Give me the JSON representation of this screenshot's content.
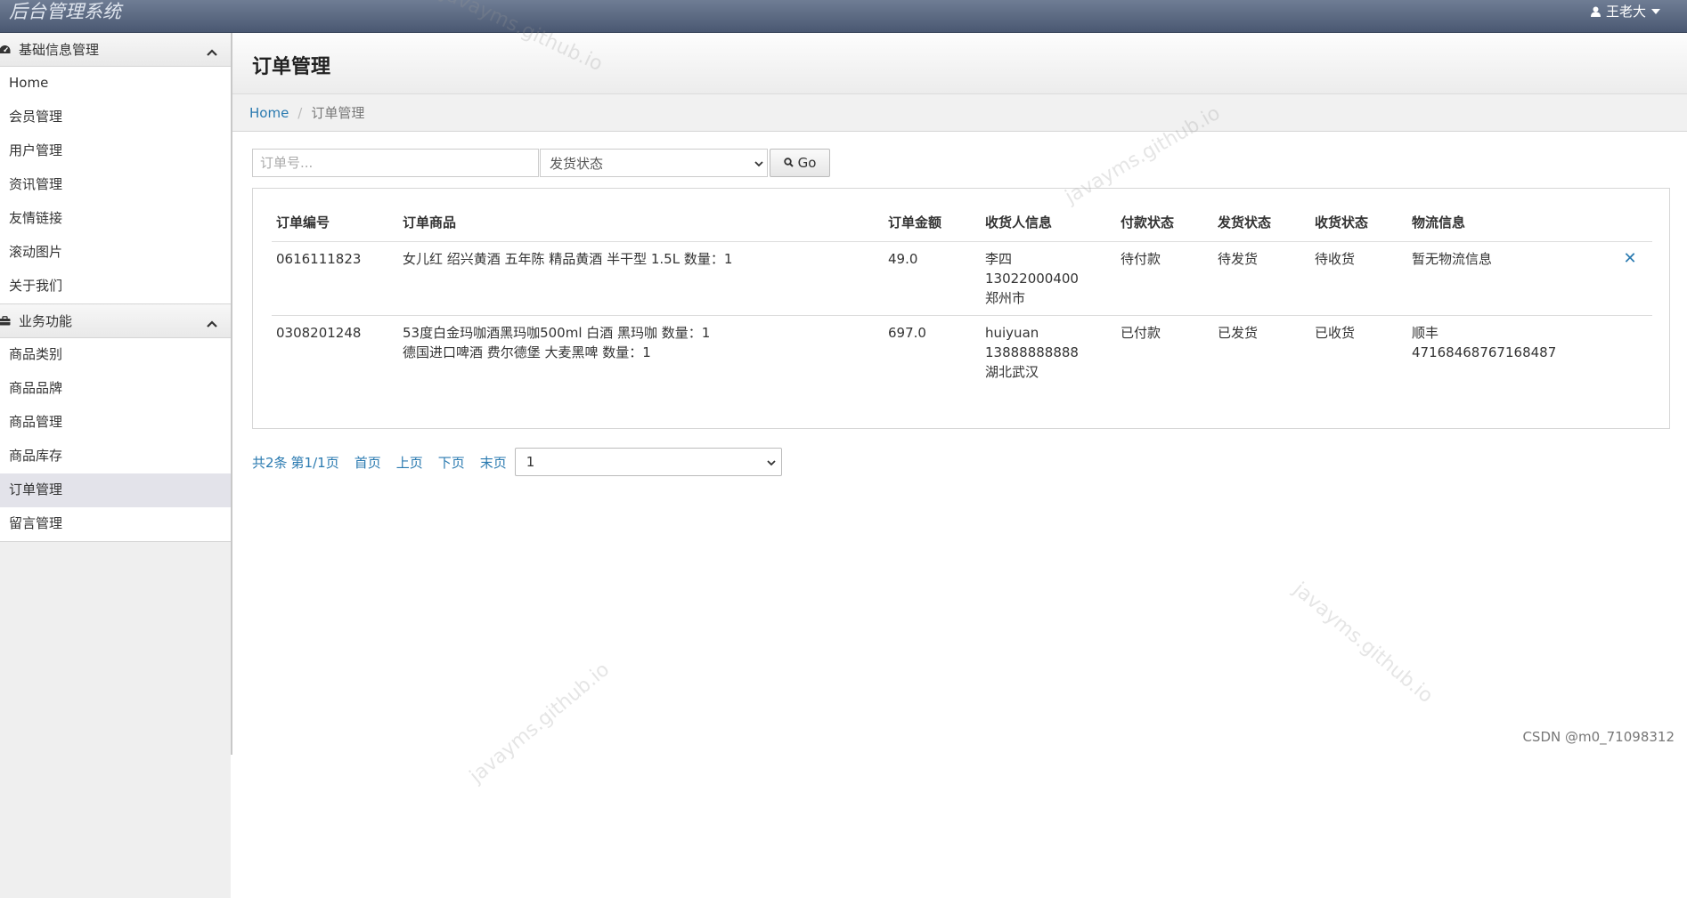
{
  "topbar": {
    "brand": "后台管理系统",
    "user_name": "王老大"
  },
  "sidebar": {
    "groups": [
      {
        "title": "基础信息管理",
        "items": [
          "Home",
          "会员管理",
          "用户管理",
          "资讯管理",
          "友情链接",
          "滚动图片",
          "关于我们"
        ]
      },
      {
        "title": "业务功能",
        "items": [
          "商品类别",
          "商品品牌",
          "商品管理",
          "商品库存",
          "订单管理",
          "留言管理"
        ]
      }
    ],
    "active_item": "订单管理"
  },
  "page": {
    "title": "订单管理"
  },
  "breadcrumb": {
    "home": "Home",
    "separator": "/",
    "current": "订单管理"
  },
  "filter": {
    "order_placeholder": "订单号...",
    "status_select_value": "发货状态",
    "go_label": "Go"
  },
  "table": {
    "headers": [
      "订单编号",
      "订单商品",
      "订单金额",
      "收货人信息",
      "付款状态",
      "发货状态",
      "收货状态",
      "物流信息"
    ],
    "rows": [
      {
        "order_no": "0616111823",
        "goods": [
          "女儿红 绍兴黄酒 五年陈 精品黄酒 半干型 1.5L   数量：1"
        ],
        "amount": "49.0",
        "receiver": [
          "李四",
          "13022000400",
          "郑州市"
        ],
        "pay_status": "待付款",
        "ship_status": "待发货",
        "receive_status": "待收货",
        "logistics": [
          "暂无物流信息"
        ],
        "delete": "✕"
      },
      {
        "order_no": "0308201248",
        "goods": [
          "53度白金玛咖酒黑玛咖500ml 白酒 黑玛咖   数量：1",
          "德国进口啤酒 费尔德堡 大麦黑啤   数量：1"
        ],
        "amount": "697.0",
        "receiver": [
          "huiyuan",
          "13888888888",
          "湖北武汉"
        ],
        "pay_status": "已付款",
        "ship_status": "已发货",
        "receive_status": "已收货",
        "logistics": [
          "顺丰",
          "47168468767168487"
        ],
        "delete": ""
      }
    ]
  },
  "pager": {
    "total": "共2条",
    "page_info": "第1/1页",
    "first": "首页",
    "prev": "上页",
    "next": "下页",
    "last": "末页",
    "page_select_value": "1"
  },
  "watermark": "javayms.github.io",
  "footer_credit": "CSDN @m0_71098312",
  "colors": {
    "link": "#2a7ab0",
    "topbar": "#56637c",
    "active_sidebar": "#e3e3ea"
  },
  "icons": {
    "user": "user-icon",
    "caret": "caret-down-icon",
    "group1": "dashboard-icon",
    "group2": "briefcase-icon",
    "search": "search-icon",
    "delete": "close-icon"
  }
}
